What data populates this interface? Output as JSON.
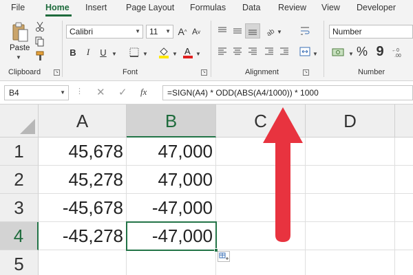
{
  "menu": {
    "file": "File",
    "home": "Home",
    "insert": "Insert",
    "page_layout": "Page Layout",
    "formulas": "Formulas",
    "data": "Data",
    "review": "Review",
    "view": "View",
    "developer": "Developer"
  },
  "ribbon": {
    "clipboard": {
      "label": "Clipboard",
      "paste_label": "Paste"
    },
    "font": {
      "label": "Font",
      "font_name": "Calibri",
      "font_size": "11",
      "bold": "B",
      "italic": "I",
      "underline": "U"
    },
    "alignment": {
      "label": "Alignment"
    },
    "number": {
      "label": "Number",
      "format": "Number",
      "percent": "%",
      "comma": "9"
    }
  },
  "formula_bar": {
    "name_box": "B4",
    "fx": "fx",
    "formula": "=SIGN(A4) * ODD(ABS(A4/1000)) * 1000"
  },
  "sheet": {
    "columns": [
      "A",
      "B",
      "C",
      "D"
    ],
    "rows": [
      "1",
      "2",
      "3",
      "4",
      "5"
    ],
    "cells": [
      [
        "45,678",
        "47,000"
      ],
      [
        "45,278",
        "47,000"
      ],
      [
        "-45,678",
        "-47,000"
      ],
      [
        "-45,278",
        "-47,000"
      ]
    ],
    "selected_cell": "B4"
  },
  "colors": {
    "accent": "#217346",
    "annotation_arrow": "#e8333f"
  },
  "icons": [
    "paste-icon",
    "cut-icon",
    "copy-icon",
    "format-painter-icon",
    "border-icon",
    "fill-color-icon",
    "font-color-icon",
    "align-icon",
    "wrap-text-icon",
    "merge-icon",
    "currency-icon",
    "cancel-icon",
    "enter-icon",
    "red-arrow-icon"
  ]
}
